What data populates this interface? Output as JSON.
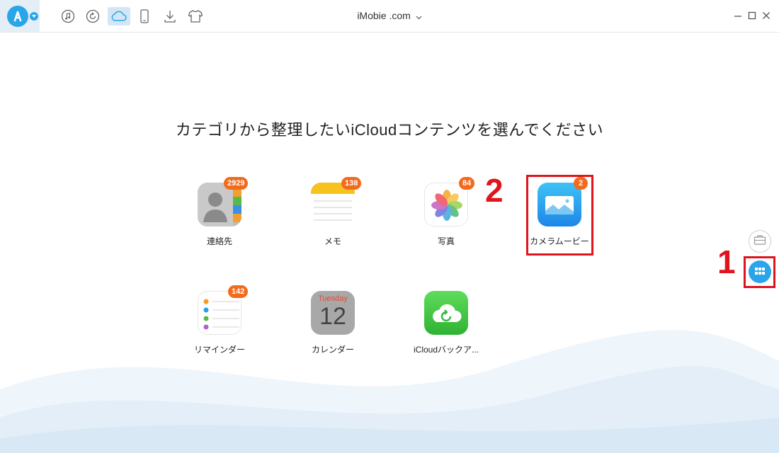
{
  "titlebar": {
    "device_name": "iMobie .com",
    "toolbar_icons": [
      "music-icon",
      "restore-icon",
      "icloud-icon",
      "phone-icon",
      "download-icon",
      "tshirt-icon"
    ]
  },
  "main": {
    "headline": "カテゴリから整理したいiCloudコンテンツを選んでください",
    "categories": [
      {
        "label": "連絡先",
        "badge": "2929"
      },
      {
        "label": "メモ",
        "badge": "138"
      },
      {
        "label": "写真",
        "badge": "84"
      },
      {
        "label": "カメラムービー",
        "badge": "2"
      },
      {
        "label": "リマインダー",
        "badge": "142"
      },
      {
        "label": "カレンダー",
        "badge": ""
      },
      {
        "label": "iCloudバックア...",
        "badge": ""
      }
    ],
    "calendar_day": "Tuesday",
    "calendar_date": "12"
  },
  "annotations": {
    "step1": "1",
    "step2": "2"
  },
  "colors": {
    "accent": "#2aa5ea",
    "badge": "#f26b1d",
    "highlight": "#e0141c"
  }
}
